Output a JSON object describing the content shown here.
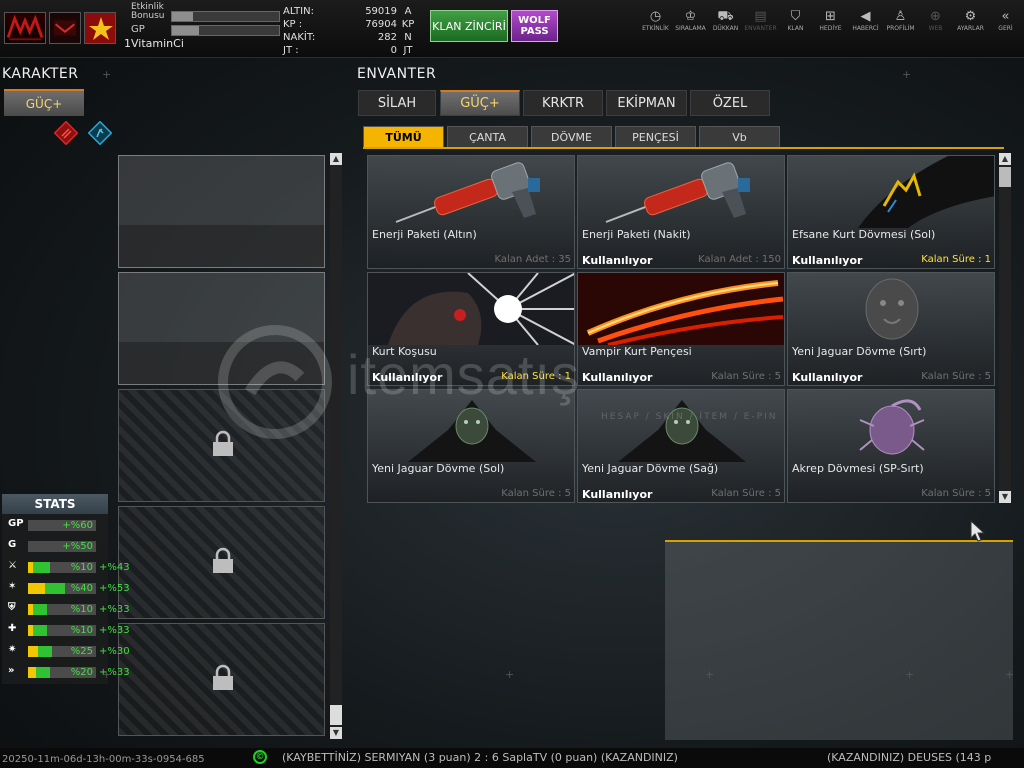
{
  "header": {
    "bonus_label": "Etkinlik Bonusu",
    "gp_label": "GP",
    "username": "1VitaminCi",
    "bonus_progress": 0.2,
    "gp_progress": 0.25,
    "currency": [
      {
        "label": "ALTIN:",
        "value": "59019",
        "unit": "A"
      },
      {
        "label": "KP   :",
        "value": "76904",
        "unit": "KP"
      },
      {
        "label": "NAKİT:",
        "value": "282",
        "unit": "N"
      },
      {
        "label": "JT   :",
        "value": "0",
        "unit": "JT"
      }
    ],
    "klan_button": "KLAN ZİNCİRİ",
    "wolf_button": "WOLF PASS",
    "nav": [
      {
        "label": "ETKİNLİK",
        "icon": "stopwatch-icon",
        "glyph": "◷",
        "enabled": true
      },
      {
        "label": "SIRALAMA",
        "icon": "medal-icon",
        "glyph": "♔",
        "enabled": true
      },
      {
        "label": "DÜKKAN",
        "icon": "cart-icon",
        "glyph": "⛟",
        "enabled": true
      },
      {
        "label": "ENVANTER",
        "icon": "inventory-icon",
        "glyph": "▤",
        "enabled": false
      },
      {
        "label": "KLAN",
        "icon": "shield-icon",
        "glyph": "⛉",
        "enabled": true
      },
      {
        "label": "HEDİYE",
        "icon": "gift-icon",
        "glyph": "⊞",
        "enabled": true
      },
      {
        "label": "HABERCİ",
        "icon": "megaphone-icon",
        "glyph": "◀",
        "enabled": true
      },
      {
        "label": "PROFİLİM",
        "icon": "profile-icon",
        "glyph": "♙",
        "enabled": true
      },
      {
        "label": "WEB",
        "icon": "globe-icon",
        "glyph": "⊕",
        "enabled": false
      },
      {
        "label": "AYARLAR",
        "icon": "gear-icon",
        "glyph": "⚙",
        "enabled": true
      },
      {
        "label": "GERİ",
        "icon": "back-icon",
        "glyph": "«",
        "enabled": true
      }
    ]
  },
  "left": {
    "title": "KARAKTER",
    "tab": "GÜÇ+",
    "stats_title": "STATS",
    "stats": [
      {
        "icon": "gp-icon",
        "glyph": "GP",
        "value": "+%60",
        "yellow": 0,
        "green": 0,
        "extra": ""
      },
      {
        "icon": "g-icon",
        "glyph": "G",
        "value": "+%50",
        "yellow": 0,
        "green": 0,
        "extra": ""
      },
      {
        "icon": "attack-stat-icon",
        "glyph": "⚔",
        "value": "%10",
        "yellow": 0.08,
        "green": 0.25,
        "extra": "+%43"
      },
      {
        "icon": "speed-stat-icon",
        "glyph": "✶",
        "value": "%40",
        "yellow": 0.25,
        "green": 0.3,
        "extra": "+%53"
      },
      {
        "icon": "defense-stat-icon",
        "glyph": "⛨",
        "value": "%10",
        "yellow": 0.08,
        "green": 0.2,
        "extra": "+%33"
      },
      {
        "icon": "health-stat-icon",
        "glyph": "✚",
        "value": "%10",
        "yellow": 0.08,
        "green": 0.2,
        "extra": "+%33"
      },
      {
        "icon": "skill-stat-icon",
        "glyph": "✷",
        "value": "%25",
        "yellow": 0.15,
        "green": 0.2,
        "extra": "+%30"
      },
      {
        "icon": "dash-stat-icon",
        "glyph": "»",
        "value": "%20",
        "yellow": 0.12,
        "green": 0.2,
        "extra": "+%33"
      }
    ]
  },
  "inventory": {
    "title": "ENVANTER",
    "tabs": [
      "SİLAH",
      "GÜÇ+",
      "KRKTR",
      "EKİPMAN",
      "ÖZEL"
    ],
    "active_tab": 1,
    "subtabs": [
      "TÜMÜ",
      "ÇANTA",
      "DÖVME",
      "PENÇESİ",
      "Vb"
    ],
    "active_subtab": 0,
    "items": [
      {
        "name": "Enerji Paketi (Altın)",
        "status": "",
        "remain": "Kalan Adet : 35",
        "highlight": false,
        "art": "injector"
      },
      {
        "name": "Enerji Paketi (Nakit)",
        "status": "Kullanılıyor",
        "remain": "Kalan Adet : 150",
        "highlight": false,
        "art": "injector"
      },
      {
        "name": "Efsane Kurt Dövmesi (Sol)",
        "status": "Kullanılıyor",
        "remain": "Kalan Süre : 1",
        "highlight": true,
        "art": "tattoo"
      },
      {
        "name": "Kurt Koşusu",
        "status": "Kullanılıyor",
        "remain": "Kalan Süre : 1",
        "highlight": true,
        "art": "wolf"
      },
      {
        "name": "Vampir Kurt Pençesi",
        "status": "Kullanılıyor",
        "remain": "Kalan Süre : 5",
        "highlight": false,
        "art": "claw"
      },
      {
        "name": "Yeni Jaguar Dövme (Sırt)",
        "status": "Kullanılıyor",
        "remain": "Kalan Süre : 5",
        "highlight": false,
        "art": "jaguar"
      },
      {
        "name": "Yeni Jaguar Dövme (Sol)",
        "status": "",
        "remain": "Kalan Süre : 5",
        "highlight": false,
        "art": "jaguar-small"
      },
      {
        "name": "Yeni Jaguar Dövme (Sağ)",
        "status": "Kullanılıyor",
        "remain": "Kalan Süre : 5",
        "highlight": false,
        "art": "jaguar-small"
      },
      {
        "name": "Akrep Dövmesi (SP-Sırt)",
        "status": "",
        "remain": "Kalan Süre : 5",
        "highlight": false,
        "art": "scorpion"
      }
    ]
  },
  "watermark": {
    "text": "itemsatış",
    "sub": "HESAP / SKIN / İTEM / E-PIN"
  },
  "ticker": {
    "code": "20250-11m-06d-13h-00m-33s-0954-685",
    "message": "(KAYBETTİNİZ) SERMIYAN (3 puan) 2 : 6 SaplaTV (0 puan) (KAZANDINIZ)",
    "message2": "(KAZANDINIZ) DEUSES (143 p"
  }
}
